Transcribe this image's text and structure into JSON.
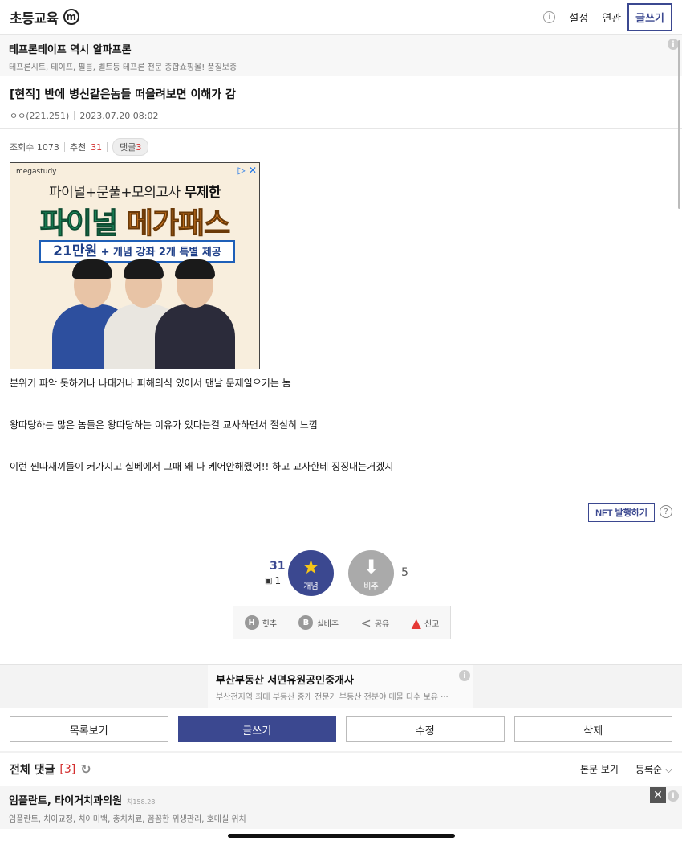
{
  "header": {
    "title": "초등교육",
    "badge": "m",
    "info_icon": "info-icon",
    "settings_label": "설정",
    "related_label": "연관",
    "write_label": "글쓰기"
  },
  "top_ad": {
    "title": "테프론테이프 역시 알파프론",
    "description": "테프론시트, 테이프, 필름, 벨트등 테프론 전문 종합쇼핑몰! 품질보증",
    "info_glyph": "i"
  },
  "post": {
    "title": "[현직] 반에 병신같은놈들 떠올려보면 이해가 감",
    "author": "ㅇㅇ(221.251)",
    "date": "2023.07.20 08:02",
    "views_label": "조회수 1073",
    "recommend_label": "추천",
    "recommend_count": "31",
    "comment_label": "댓글",
    "comment_count": "3",
    "paragraphs": [
      "분위기 파악 못하거나 나대거나 피해의식 있어서 맨날 문제일으키는 놈",
      "왕따당하는 많은 놈들은 왕따당하는 이유가 있다는걸 교사하면서 절실히 느낌",
      "이런 찐따새끼들이 커가지고 실베에서 그때 왜 나 케어안해줬어!! 하고 교사한테 징징대는거겠지"
    ]
  },
  "banner_ad": {
    "brand": "megastudy",
    "adchoices": "▷ ✕",
    "line1_prefix": "파이널+문풀+모의고사",
    "line1_bold": "무제한",
    "line2_green": "파이널",
    "line2_orange": "메가패스",
    "line3_big": "21만원",
    "line3_rest": "+ 개념 강좌 2개 특별 제공",
    "colors": {
      "green": "#1ea36a",
      "orange": "#f08c2a",
      "blue": "#1e5fb8"
    }
  },
  "nft": {
    "label": "NFT 발행하기",
    "help": "?"
  },
  "vote": {
    "up_count": "31",
    "up_sub": "1",
    "up_label": "개념",
    "down_label": "비추",
    "down_count": "5",
    "up_icon": "star-icon",
    "down_icon": "arrow-down-icon"
  },
  "actions": [
    {
      "icon": "H",
      "label": "힛추"
    },
    {
      "icon": "B",
      "label": "실베추"
    },
    {
      "icon": "share",
      "label": "공유"
    },
    {
      "icon": "siren",
      "label": "신고"
    }
  ],
  "mid_ad": {
    "title": "부산부동산 서면유원공인중개사",
    "description": "부산전지역 최대 부동산 중개 전문가 부동산 전분야 매물 다수 보유 ···"
  },
  "buttons": {
    "list": "목록보기",
    "write": "글쓰기",
    "edit": "수정",
    "delete": "삭제"
  },
  "comments": {
    "title": "전체 댓글",
    "count": "[3]",
    "view_body": "본문 보기",
    "sort": "등록순"
  },
  "bottom_ad": {
    "title": "임플란트, 타이거치과의원",
    "tag": "치158.28",
    "description": "임플란트, 치아교정, 치아미백, 충치치료, 꼼꼼한 위생관리, 호매실 위치",
    "close": "✕"
  },
  "theme": {
    "accent": "#3b4890",
    "red": "#d32f2f"
  }
}
